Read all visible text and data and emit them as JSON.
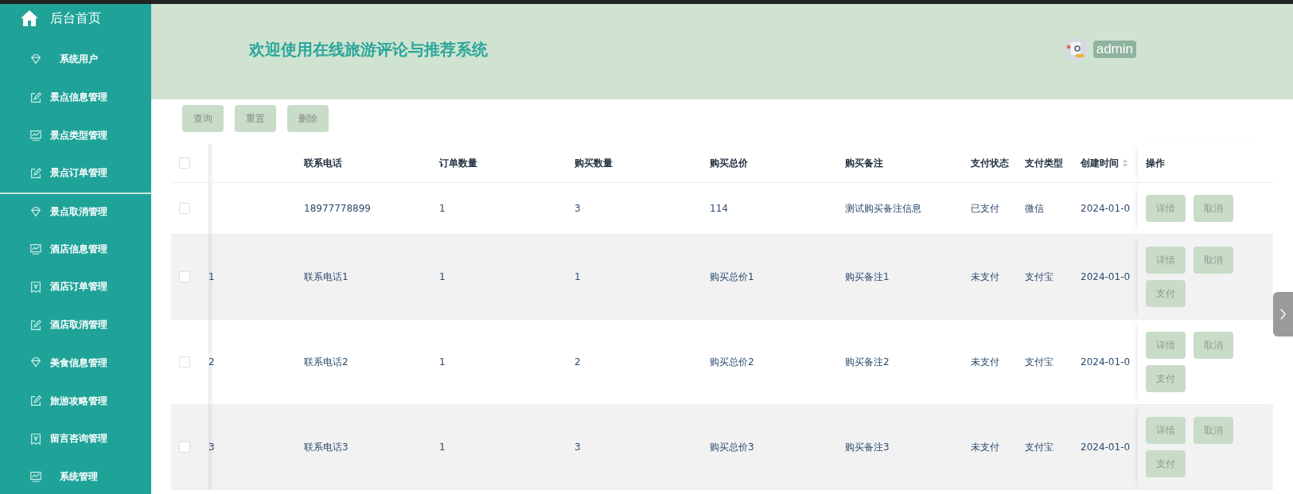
{
  "sidebar": {
    "home": {
      "label": "后台首页"
    },
    "items": [
      {
        "label": "系统用户",
        "kind": "diamond",
        "selected": false
      },
      {
        "label": "景点信息管理",
        "kind": "edit",
        "selected": false
      },
      {
        "label": "景点类型管理",
        "kind": "chart",
        "selected": false
      },
      {
        "label": "景点订单管理",
        "kind": "edit",
        "selected": false
      },
      {
        "label": "景点取消管理",
        "kind": "diamond",
        "selected": true
      },
      {
        "label": "酒店信息管理",
        "kind": "chart",
        "selected": false
      },
      {
        "label": "酒店订单管理",
        "kind": "receipt",
        "selected": false
      },
      {
        "label": "酒店取消管理",
        "kind": "edit",
        "selected": false
      },
      {
        "label": "美食信息管理",
        "kind": "diamond",
        "selected": false
      },
      {
        "label": "旅游攻略管理",
        "kind": "edit",
        "selected": false
      },
      {
        "label": "留言咨询管理",
        "kind": "receipt",
        "selected": false
      },
      {
        "label": "系统管理",
        "kind": "chart",
        "selected": false
      }
    ]
  },
  "header": {
    "title": "欢迎使用在线旅游评论与推荐系统",
    "user": "admin"
  },
  "toolbar": [
    "查询",
    "重置",
    "删除"
  ],
  "table": {
    "header_checked": false,
    "columns": [
      {
        "label": "联系电话",
        "sortable": false
      },
      {
        "label": "订单数量",
        "sortable": false
      },
      {
        "label": "购买数量",
        "sortable": false
      },
      {
        "label": "购买总价",
        "sortable": false
      },
      {
        "label": "购买备注",
        "sortable": false
      },
      {
        "label": "支付状态",
        "sortable": false
      },
      {
        "label": "支付类型",
        "sortable": false
      },
      {
        "label": "创建时间",
        "sortable": true
      },
      {
        "label": "操作",
        "sortable": false
      }
    ],
    "rows": [
      {
        "checked": false,
        "cells": [
          "18977778899",
          "1",
          "3",
          "114",
          "测试购买备注信息",
          "已支付",
          "微信",
          "2024-01-0"
        ],
        "actions": [
          "详情",
          "取消"
        ]
      },
      {
        "checked": false,
        "column_1": "1",
        "cells": [
          "联系电话1",
          "1",
          "1",
          "购买总价1",
          "购买备注1",
          "未支付",
          "支付宝",
          "2024-01-0"
        ],
        "actions": [
          "详情",
          "取消",
          "支付"
        ]
      },
      {
        "checked": false,
        "column_1": "2",
        "cells": [
          "联系电话2",
          "1",
          "2",
          "购买总价2",
          "购买备注2",
          "未支付",
          "支付宝",
          "2024-01-0"
        ],
        "actions": [
          "详情",
          "取消",
          "支付"
        ]
      },
      {
        "checked": false,
        "column_1": "3",
        "cells": [
          "联系电话3",
          "1",
          "3",
          "购买总价3",
          "购买备注3",
          "未支付",
          "支付宝",
          "2024-01-0"
        ],
        "actions": [
          "详情",
          "取消",
          "支付"
        ]
      }
    ]
  }
}
